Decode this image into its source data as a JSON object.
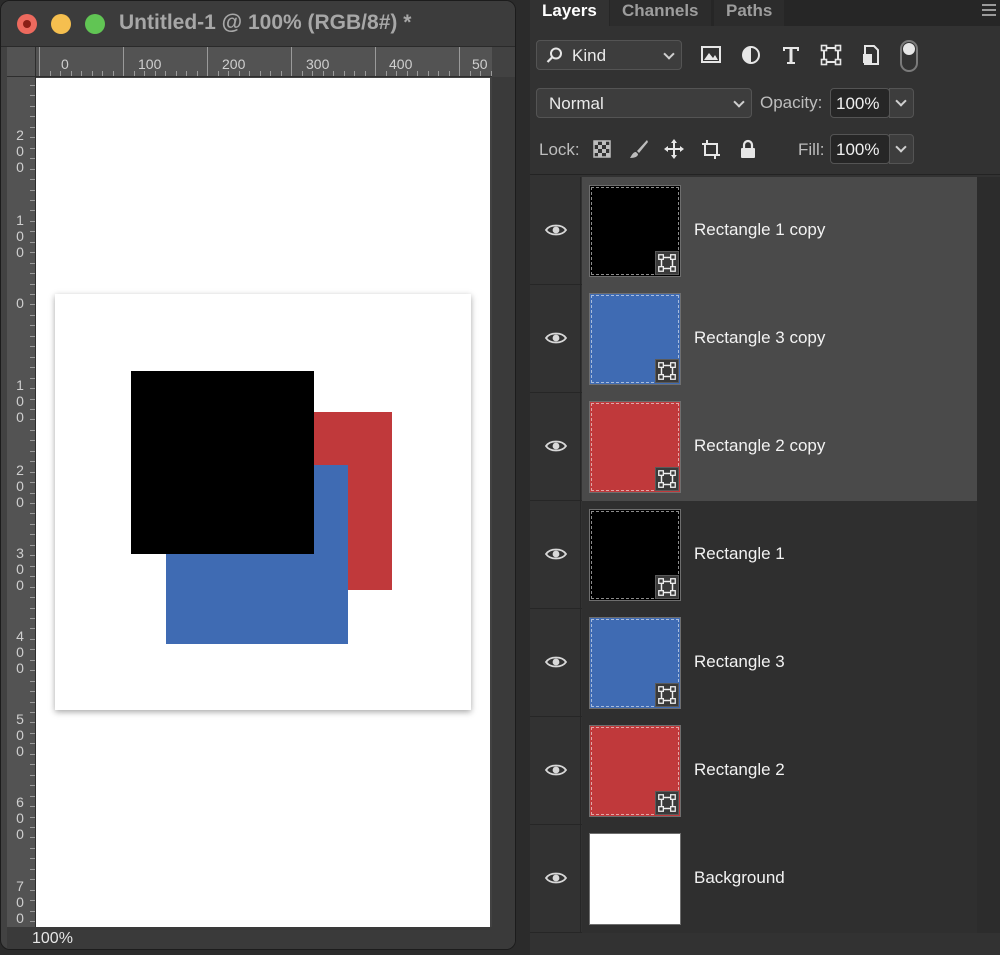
{
  "document": {
    "title": "Untitled-1 @ 100% (RGB/8#) *",
    "zoom": "100%",
    "ruler_h_labels": [
      "0",
      "100",
      "200",
      "300",
      "400",
      "50"
    ],
    "ruler_v_labels": [
      "2\n0\n0",
      "1\n0\n0",
      "0",
      "1\n0\n0",
      "2\n0\n0",
      "3\n0\n0",
      "4\n0\n0",
      "5\n0\n0",
      "6\n0\n0",
      "7\n0\n0"
    ]
  },
  "panel": {
    "tabs": [
      "Layers",
      "Channels",
      "Paths"
    ],
    "active_tab": "Layers",
    "filter_kind": "Kind",
    "blend_mode": "Normal",
    "opacity_label": "Opacity:",
    "opacity_value": "100%",
    "lock_label": "Lock:",
    "fill_label": "Fill:",
    "fill_value": "100%"
  },
  "layers": [
    {
      "name": "Rectangle 1 copy",
      "color": "#000000",
      "selected": true,
      "shape": true,
      "locked": false
    },
    {
      "name": "Rectangle 3 copy",
      "color": "#3f6bb3",
      "selected": true,
      "shape": true,
      "locked": false
    },
    {
      "name": "Rectangle 2 copy",
      "color": "#c0393b",
      "selected": true,
      "shape": true,
      "locked": false
    },
    {
      "name": "Rectangle 1",
      "color": "#000000",
      "selected": false,
      "shape": true,
      "locked": false
    },
    {
      "name": "Rectangle 3",
      "color": "#3f6bb3",
      "selected": false,
      "shape": true,
      "locked": false
    },
    {
      "name": "Rectangle 2",
      "color": "#c0393b",
      "selected": false,
      "shape": true,
      "locked": false
    },
    {
      "name": "Background",
      "color": "#ffffff",
      "selected": false,
      "shape": false,
      "locked": true
    }
  ],
  "colors": {
    "black": "#000000",
    "blue": "#3f6bb3",
    "red": "#c0393b",
    "white": "#ffffff"
  }
}
